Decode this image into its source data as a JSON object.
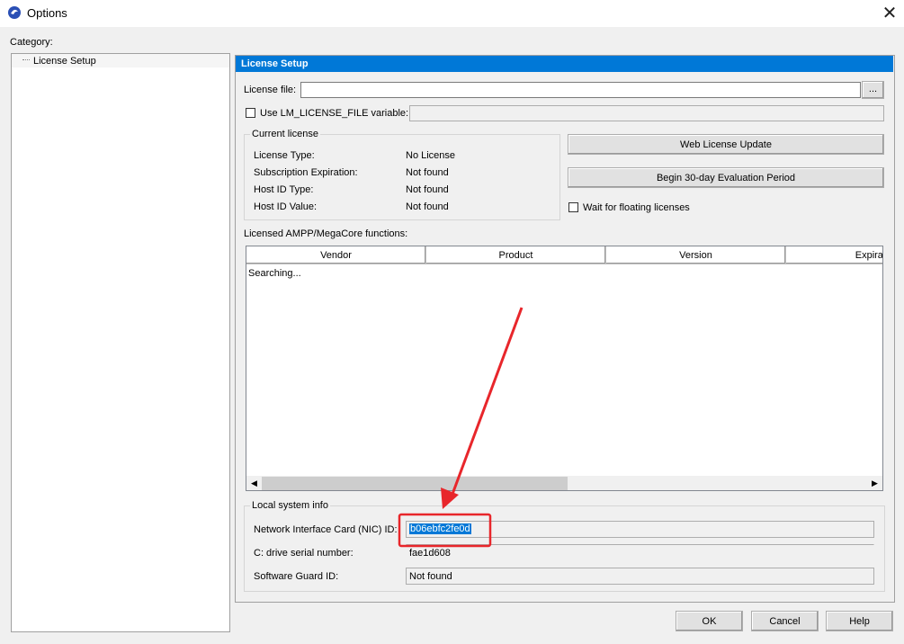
{
  "window": {
    "title": "Options"
  },
  "category": {
    "label": "Category:",
    "items": [
      "License Setup"
    ]
  },
  "section": {
    "header": "License Setup"
  },
  "license_file": {
    "label": "License file:",
    "value": "",
    "browse_label": "..."
  },
  "lm_license": {
    "label": "Use LM_LICENSE_FILE variable:",
    "checked": false,
    "value": ""
  },
  "current_license": {
    "title": "Current license",
    "rows": [
      {
        "label": "License Type:",
        "value": "No License"
      },
      {
        "label": "Subscription Expiration:",
        "value": "Not found"
      },
      {
        "label": "Host ID Type:",
        "value": "Not found"
      },
      {
        "label": "Host ID Value:",
        "value": "Not found"
      }
    ]
  },
  "buttons": {
    "web_update": "Web License Update",
    "evaluation": "Begin 30-day Evaluation Period",
    "ok": "OK",
    "cancel": "Cancel",
    "help": "Help"
  },
  "floating": {
    "label": "Wait for floating licenses",
    "checked": false
  },
  "functions": {
    "label": "Licensed AMPP/MegaCore functions:",
    "columns": [
      "Vendor",
      "Product",
      "Version",
      "Expirat"
    ],
    "status": "Searching..."
  },
  "local_info": {
    "title": "Local system info",
    "nic_label": "Network Interface Card (NIC) ID:",
    "nic_value": "b06ebfc2fe0d",
    "drive_label": "C: drive serial number:",
    "drive_value": "fae1d608",
    "guard_label": "Software Guard ID:",
    "guard_value": "Not found"
  },
  "colors": {
    "header": "#0078d7",
    "annotation": "#e8262b"
  }
}
